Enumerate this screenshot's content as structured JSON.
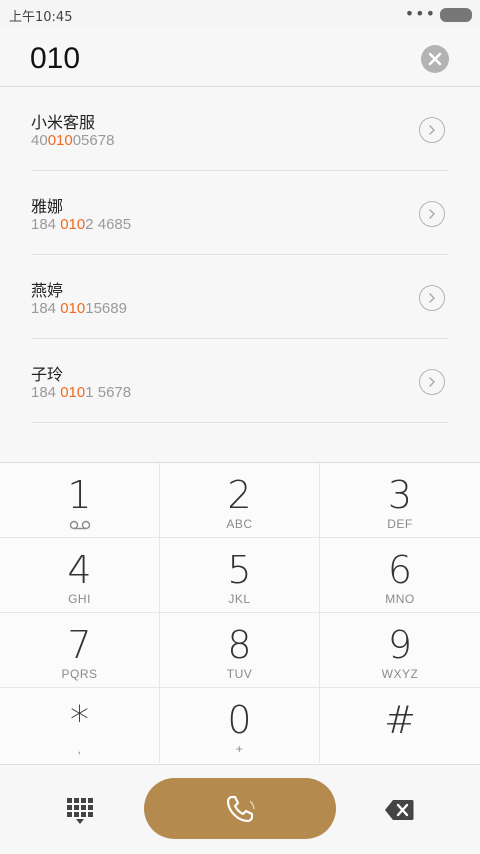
{
  "status_bar": {
    "time": "上午10:45",
    "dots": "•••"
  },
  "search": {
    "query": "010"
  },
  "results": [
    {
      "name": "小米客服",
      "number_pre": "40",
      "number_match": "010",
      "number_post": "05678"
    },
    {
      "name": "雅娜",
      "number_pre": "184 ",
      "number_match": "010",
      "number_post": "2 4685"
    },
    {
      "name": "燕婷",
      "number_pre": "184 ",
      "number_match": "010",
      "number_post": "15689"
    },
    {
      "name": "子玲",
      "number_pre": "184 ",
      "number_match": "010",
      "number_post": "1 5678"
    }
  ],
  "dialpad": {
    "keys": [
      {
        "digit": "1",
        "letters": ""
      },
      {
        "digit": "2",
        "letters": "ABC"
      },
      {
        "digit": "3",
        "letters": "DEF"
      },
      {
        "digit": "4",
        "letters": "GHI"
      },
      {
        "digit": "5",
        "letters": "JKL"
      },
      {
        "digit": "6",
        "letters": "MNO"
      },
      {
        "digit": "7",
        "letters": "PQRS"
      },
      {
        "digit": "8",
        "letters": "TUV"
      },
      {
        "digit": "9",
        "letters": "WXYZ"
      },
      {
        "digit": "*",
        "letters": ","
      },
      {
        "digit": "0",
        "letters": "+"
      },
      {
        "digit": "#",
        "letters": ""
      }
    ]
  },
  "colors": {
    "accent": "#f06a20",
    "call_button": "#b58a4f"
  },
  "icons": {
    "clear": "close-icon",
    "detail": "chevron-right-icon",
    "voicemail": "voicemail-icon",
    "dialpad_toggle": "dialpad-grid-icon",
    "call": "phone-icon",
    "backspace": "backspace-icon"
  }
}
